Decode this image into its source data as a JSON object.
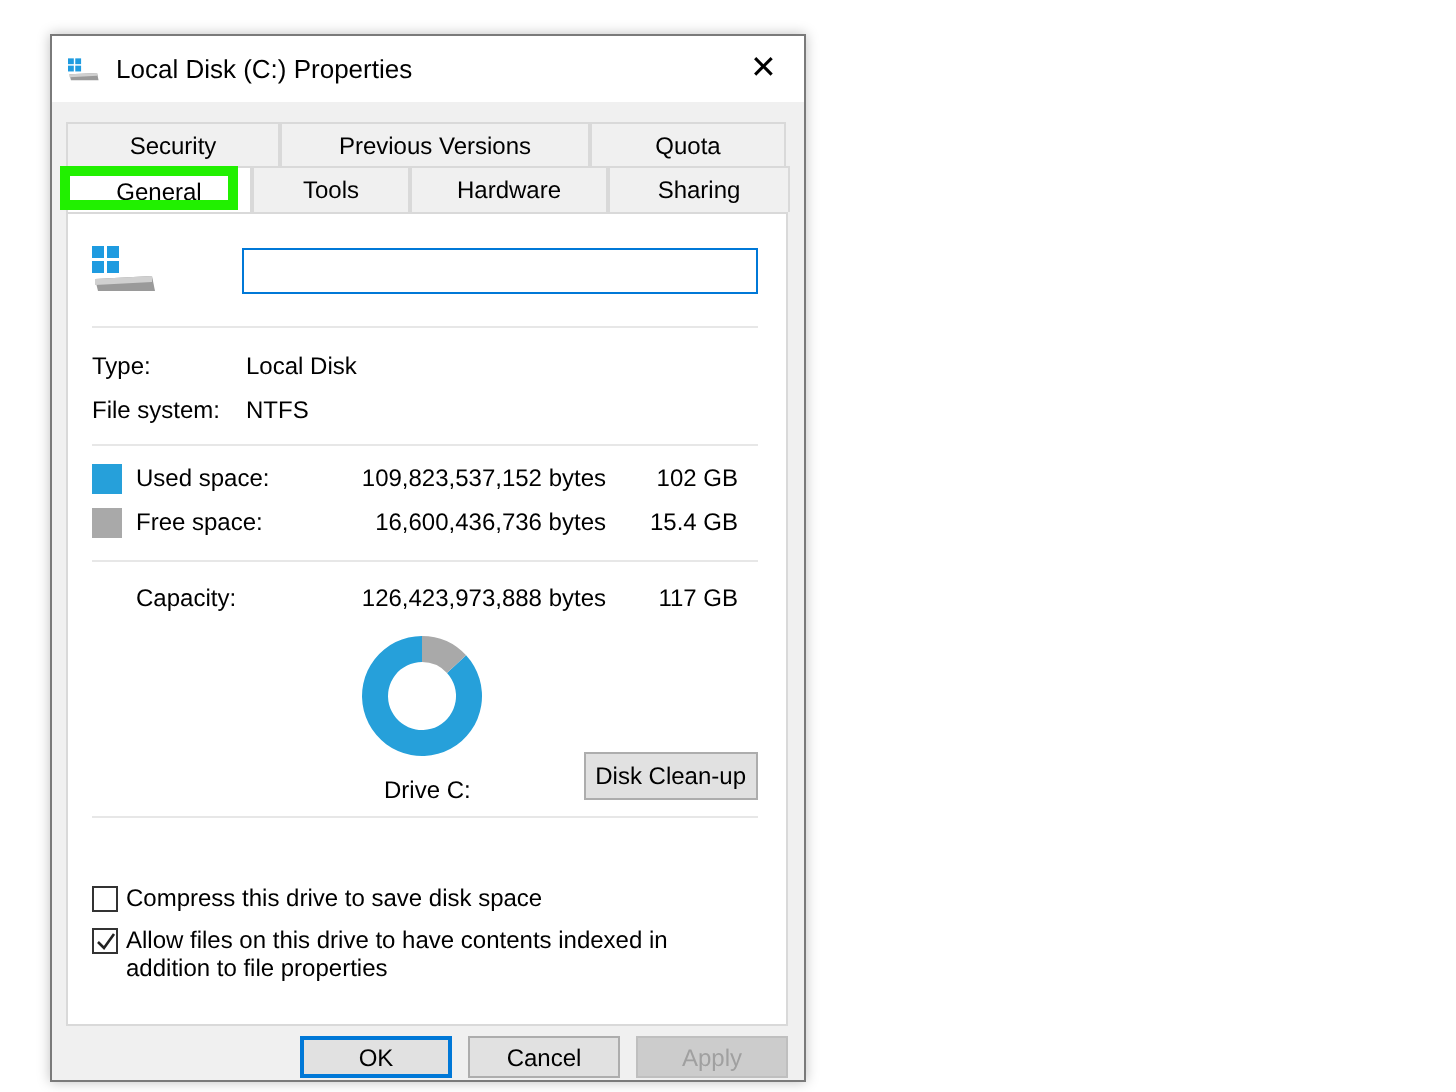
{
  "window": {
    "title": "Local Disk (C:) Properties",
    "close": "✕"
  },
  "tabs_back": [
    {
      "label": "Security",
      "selected": false
    },
    {
      "label": "Previous Versions",
      "selected": false
    },
    {
      "label": "Quota",
      "selected": false
    }
  ],
  "tabs_front": [
    {
      "label": "General",
      "selected": true,
      "highlighted": true
    },
    {
      "label": "Tools",
      "selected": false,
      "highlighted": false
    },
    {
      "label": "Hardware",
      "selected": false,
      "highlighted": false
    },
    {
      "label": "Sharing",
      "selected": false,
      "highlighted": false
    }
  ],
  "info": [
    {
      "label": "Type:",
      "value": "Local Disk"
    },
    {
      "label": "File system:",
      "value": "NTFS"
    }
  ],
  "space": [
    {
      "label": "Used space:",
      "bytes": "109,823,537,152 bytes",
      "size": "102 GB",
      "color": "#26a0da"
    },
    {
      "label": "Free space:",
      "bytes": "16,600,436,736 bytes",
      "size": "15.4 GB",
      "color": "#a9a9a9"
    }
  ],
  "capacity": {
    "label": "Capacity:",
    "bytes": "126,423,973,888 bytes",
    "size": "117 GB"
  },
  "usage_chart": {
    "chart_data": {
      "type": "donut",
      "values": [
        86.87,
        13.13
      ]
    },
    "caption": "Drive C:"
  },
  "cleanup_button": "Disk Clean-up",
  "options": [
    {
      "label": "Compress this drive to save disk space",
      "checked": false
    },
    {
      "label": "Allow files on this drive to have contents indexed in addition to file properties",
      "checked": true
    }
  ],
  "buttons": [
    {
      "label": "OK",
      "kind": "default"
    },
    {
      "label": "Cancel",
      "kind": "normal"
    },
    {
      "label": "Apply",
      "kind": "disabled"
    }
  ]
}
